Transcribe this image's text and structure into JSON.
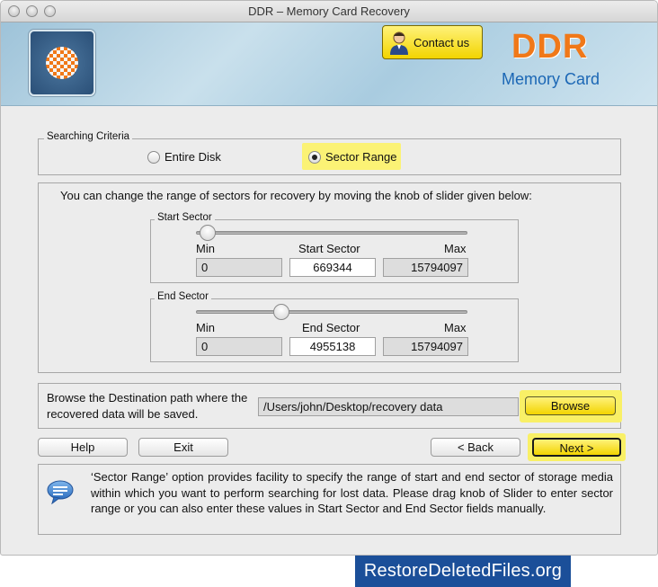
{
  "window": {
    "title": "DDR – Memory Card Recovery"
  },
  "header": {
    "contact_label": "Contact us",
    "brand": "DDR",
    "brand_sub": "Memory Card"
  },
  "criteria": {
    "legend": "Searching Criteria",
    "options": [
      {
        "label": "Entire Disk",
        "selected": false
      },
      {
        "label": "Sector Range",
        "selected": true
      }
    ]
  },
  "range": {
    "instruction": "You can change the range of sectors for recovery by moving the knob of slider given below:",
    "start": {
      "legend": "Start Sector",
      "min_label": "Min",
      "mid_label": "Start Sector",
      "max_label": "Max",
      "min_value": "0",
      "value": "669344",
      "max_value": "15794097",
      "slider_fraction": 0.042
    },
    "end": {
      "legend": "End Sector",
      "min_label": "Min",
      "mid_label": "End Sector",
      "max_label": "Max",
      "min_value": "0",
      "value": "4955138",
      "max_value": "15794097",
      "slider_fraction": 0.314
    }
  },
  "destination": {
    "description": "Browse the Destination path where the recovered data will be saved.",
    "path": "/Users/john/Desktop/recovery data",
    "browse_label": "Browse"
  },
  "nav": {
    "help_label": "Help",
    "exit_label": "Exit",
    "back_label": "< Back",
    "next_label": "Next >"
  },
  "info": {
    "text": "‘Sector Range’ option provides facility to specify the range of start and end sector of storage media within which you want to perform searching for lost data. Please drag knob of Slider to enter sector range or you can also enter these values in Start Sector and End Sector fields manually."
  },
  "footer": {
    "text": "RestoreDeletedFiles.org"
  },
  "colors": {
    "highlight": "#fbf275",
    "brand_orange": "#f07818",
    "brand_blue": "#1b67b5",
    "footer_bg": "#1b4f99"
  }
}
